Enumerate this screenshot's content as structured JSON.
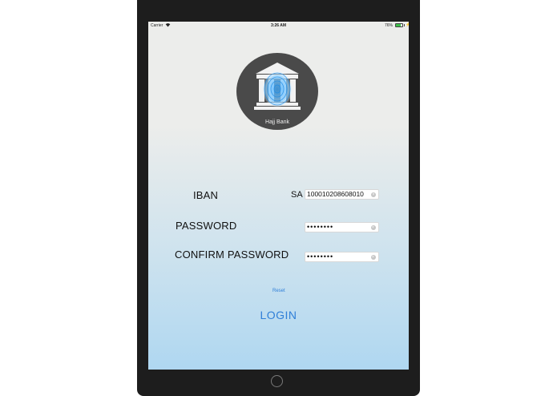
{
  "status_bar": {
    "carrier": "Carrier",
    "time": "3:26 AM",
    "battery": "76%",
    "battery_level": 0.76
  },
  "logo": {
    "caption": "Hajj Bank"
  },
  "form": {
    "iban_label": "IBAN",
    "iban_prefix": "SA",
    "iban_value": "100010208608010",
    "password_label": "PASSWORD",
    "password_value": "••••••••",
    "confirm_label": "CONFIRM PASSWORD",
    "confirm_value": "••••••••"
  },
  "actions": {
    "reset_label": "Reset",
    "login_label": "LOGIN"
  },
  "icons": {
    "wifi": "wifi-icon",
    "battery": "battery-icon",
    "bank": "bank-icon",
    "clear": "clear-icon",
    "home": "home-button"
  },
  "colors": {
    "accent": "#2f7fd8",
    "logo_bg": "#4a4a4a",
    "bezel": "#1d1d1d"
  }
}
